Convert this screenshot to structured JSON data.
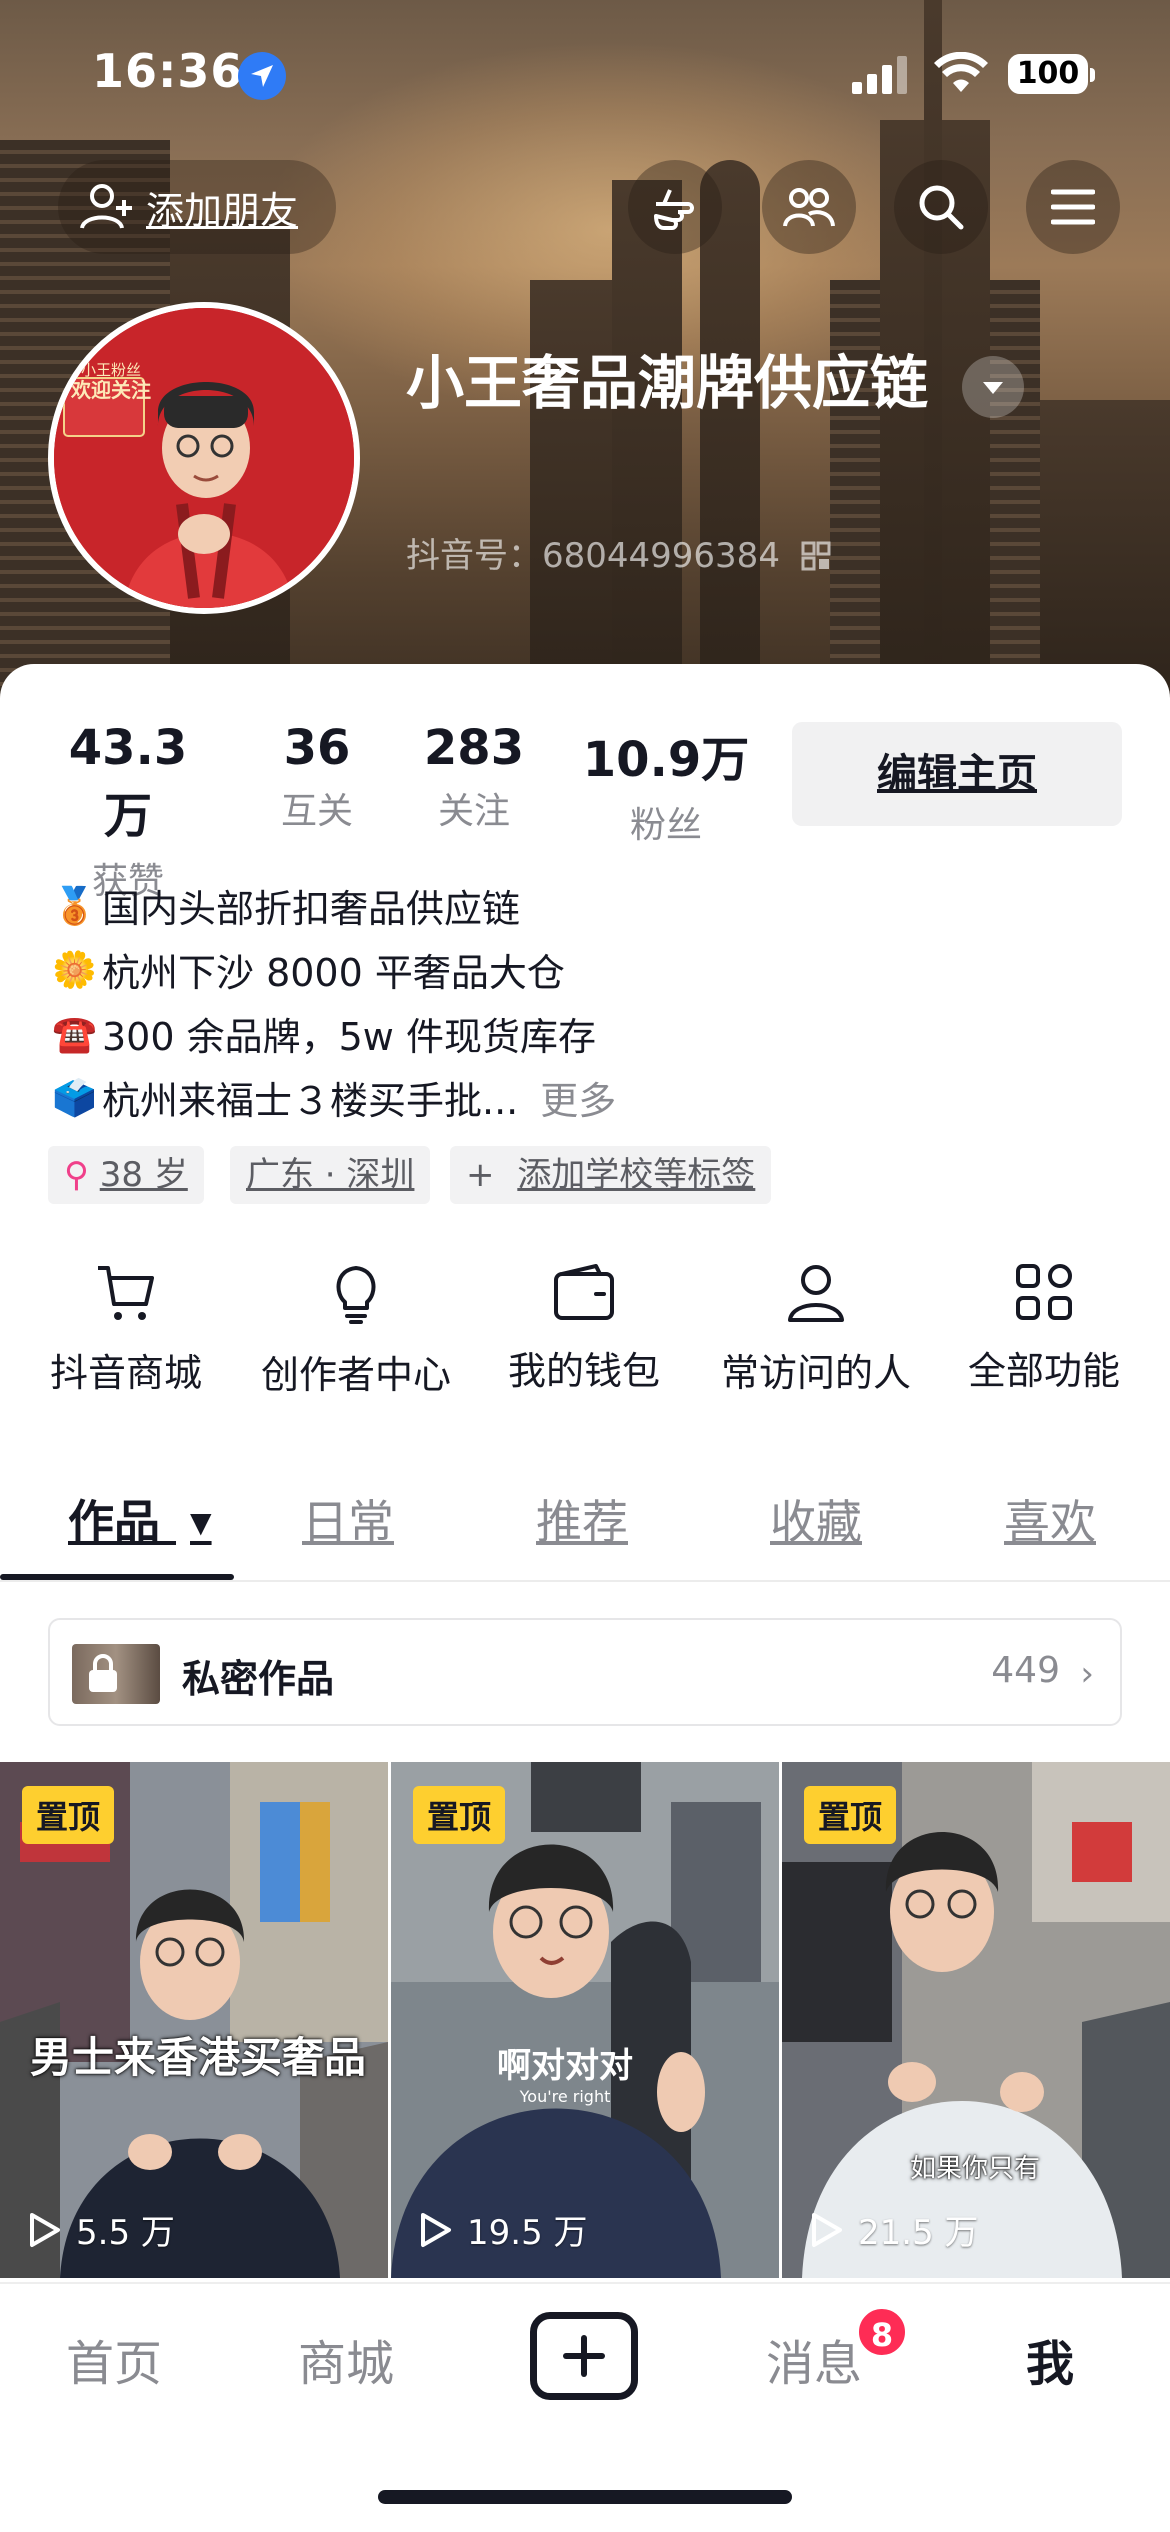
{
  "status_bar": {
    "time": "16:36",
    "battery": "100"
  },
  "header": {
    "add_friend_label": "添加朋友",
    "nickname": "小王奢品潮牌供应链",
    "douyin_id": "抖音号：68044996384",
    "avatar_caption_line1": "小王粉丝",
    "avatar_caption_line2": "欢迎关注"
  },
  "stats": [
    {
      "value": "43.3万",
      "label": "获赞"
    },
    {
      "value": "36",
      "label": "互关"
    },
    {
      "value": "283",
      "label": "关注"
    },
    {
      "value": "10.9万",
      "label": "粉丝"
    }
  ],
  "edit_button": "编辑主页",
  "bio": [
    {
      "emoji": "🥉",
      "text": "国内头部折扣奢品供应链"
    },
    {
      "emoji": "🌼",
      "text": "杭州下沙 8000 平奢品大仓"
    },
    {
      "emoji": "☎️",
      "text": "300 余品牌，5w 件现货库存"
    },
    {
      "emoji": "🗳️",
      "text": "杭州来福士３楼买手批..."
    }
  ],
  "bio_more": "更多",
  "tags": {
    "age": "38 岁",
    "location": "广东 · 深圳",
    "add_school": "添加学校等标签",
    "female_icon": "female-icon"
  },
  "features": [
    {
      "label": "抖音商城",
      "icon": "cart-icon"
    },
    {
      "label": "创作者中心",
      "icon": "bulb-icon"
    },
    {
      "label": "我的钱包",
      "icon": "wallet-icon"
    },
    {
      "label": "常访问的人",
      "icon": "person-icon"
    },
    {
      "label": "全部功能",
      "icon": "grid-icon"
    }
  ],
  "tabs": [
    "作品",
    "日常",
    "推荐",
    "收藏",
    "喜欢"
  ],
  "private_works": {
    "title": "私密作品",
    "count": "449"
  },
  "videos": [
    {
      "pin": "置顶",
      "plays": "5.5 万",
      "caption": "男士来香港买奢品"
    },
    {
      "pin": "置顶",
      "plays": "19.5 万",
      "shirt_text": "啊对对对",
      "shirt_sub": "You're right"
    },
    {
      "pin": "置顶",
      "plays": "21.5 万",
      "caption": "如果你只有"
    }
  ],
  "bottom_nav": [
    "首页",
    "商城",
    "消息",
    "我"
  ],
  "message_badge": "8",
  "colors": {
    "accent_red": "#fe2c55",
    "pin_yellow": "#fecf2f",
    "text_primary": "#161823",
    "text_secondary": "#8a8b91"
  }
}
